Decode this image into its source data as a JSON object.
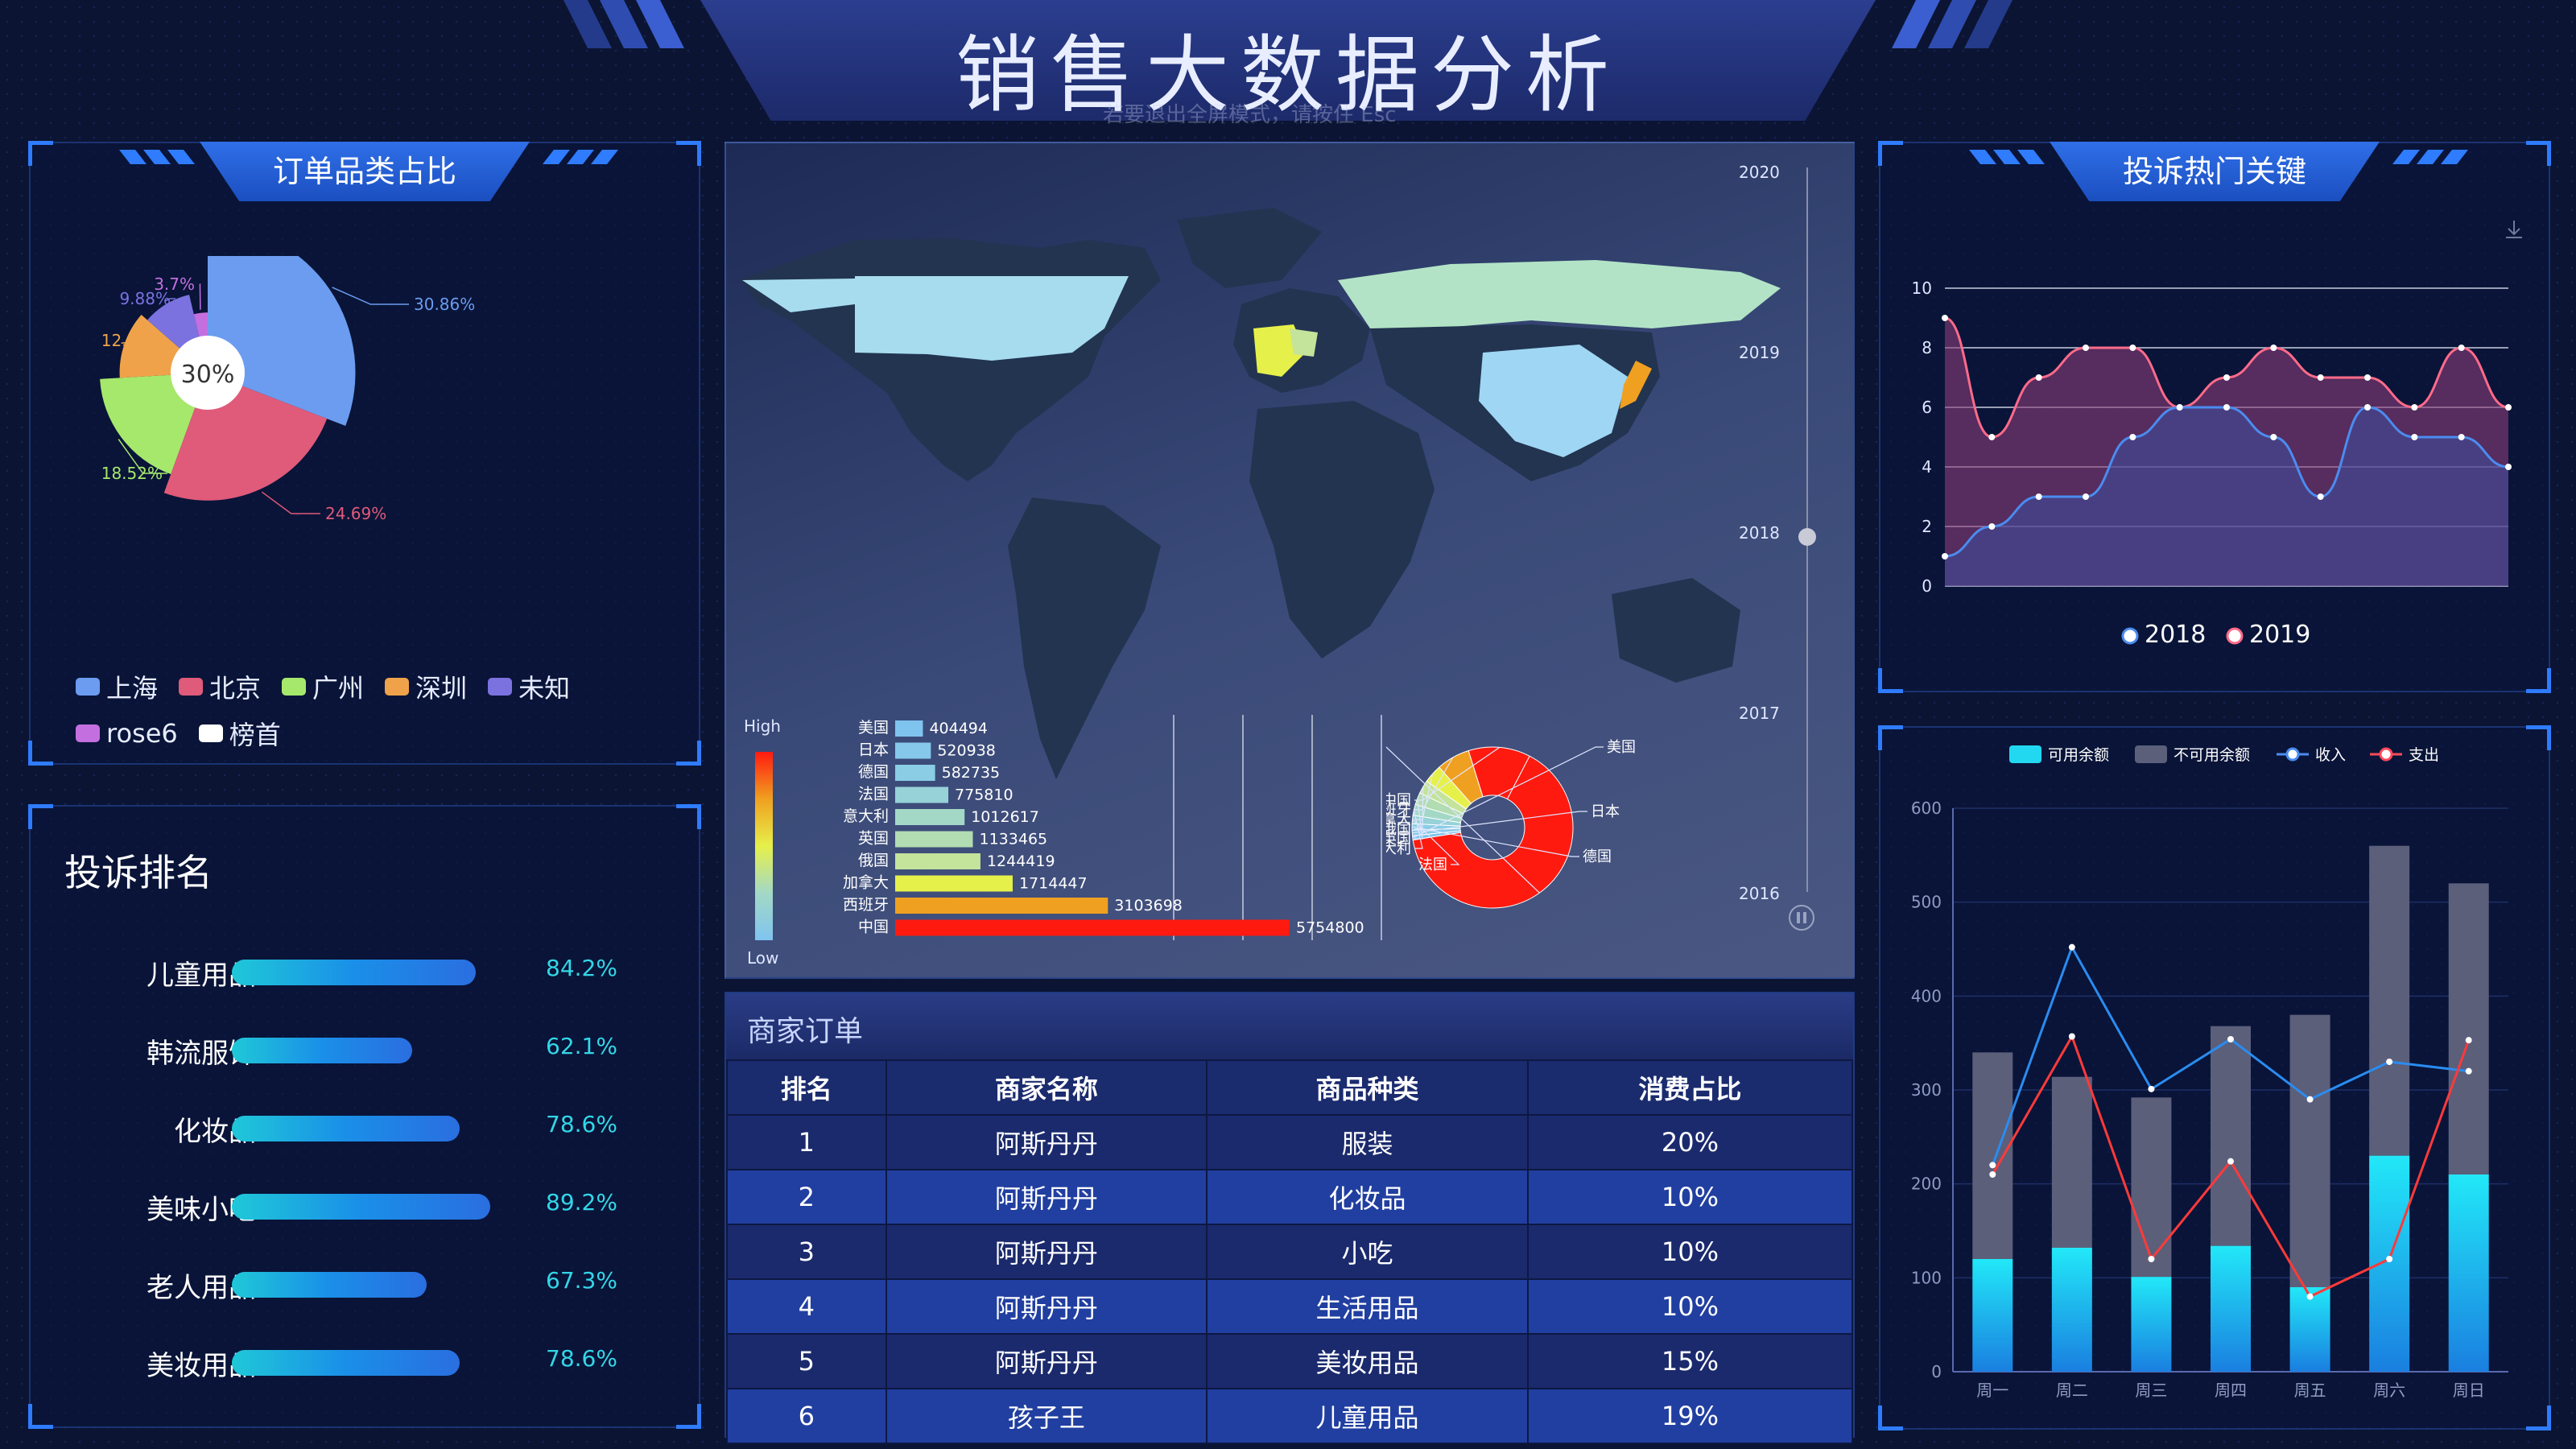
{
  "page": {
    "title": "销售大数据分析",
    "esc_tip": "若要退出全屏模式，请按住 Esc"
  },
  "colors": {
    "background": "#0b1433",
    "accent": "#2f7cff",
    "cyan": "#22d8f0"
  },
  "order_category_panel": {
    "title": "订单品类占比",
    "center_label": "30%",
    "legend": [
      {
        "name": "上海",
        "color": "#6b9cf0"
      },
      {
        "name": "北京",
        "color": "#e05a7a"
      },
      {
        "name": "广州",
        "color": "#a6e86b"
      },
      {
        "name": "深圳",
        "color": "#f0a24a"
      },
      {
        "name": "未知",
        "color": "#7b72e0"
      },
      {
        "name": "rose6",
        "color": "#c46fe0"
      },
      {
        "name": "榜首",
        "color": "#ffffff"
      }
    ]
  },
  "complaint_rank_panel": {
    "title": "投诉排名",
    "items": [
      {
        "name": "儿童用品",
        "value": 84.2,
        "label": "84.2%"
      },
      {
        "name": "韩流服饰",
        "value": 62.1,
        "label": "62.1%"
      },
      {
        "name": "化妆品",
        "value": 78.6,
        "label": "78.6%"
      },
      {
        "name": "美味小吃",
        "value": 89.2,
        "label": "89.2%"
      },
      {
        "name": "老人用品",
        "value": 67.3,
        "label": "67.3%"
      },
      {
        "name": "美妆用品",
        "value": 78.6,
        "label": "78.6%"
      }
    ]
  },
  "map_panel": {
    "timeline": [
      "2020",
      "2019",
      "2018",
      "2017",
      "2016"
    ],
    "timeline_current": "2018",
    "visual_map": {
      "high": "High",
      "low": "Low"
    },
    "countries_selected_regions": [
      "美国",
      "中国",
      "日本",
      "德国",
      "法国",
      "英国",
      "意大利",
      "西班牙",
      "加拿大",
      "俄国"
    ]
  },
  "complaint_keyword_panel": {
    "title": "投诉热门关键",
    "legend": [
      {
        "name": "2018",
        "color": "#4a8cf0"
      },
      {
        "name": "2019",
        "color": "#ff6b8a"
      }
    ]
  },
  "merchant_orders_panel": {
    "title": "商家订单",
    "headers": [
      "排名",
      "商家名称",
      "商品种类",
      "消费占比"
    ],
    "rows": [
      [
        "1",
        "阿斯丹丹",
        "服装",
        "20%"
      ],
      [
        "2",
        "阿斯丹丹",
        "化妆品",
        "10%"
      ],
      [
        "3",
        "阿斯丹丹",
        "小吃",
        "10%"
      ],
      [
        "4",
        "阿斯丹丹",
        "生活用品",
        "10%"
      ],
      [
        "5",
        "阿斯丹丹",
        "美妆用品",
        "15%"
      ],
      [
        "6",
        "孩子王",
        "儿童用品",
        "19%"
      ]
    ]
  },
  "balance_panel": {
    "legend": [
      {
        "name": "可用余额",
        "color": "#22d8f0"
      },
      {
        "name": "不可用余额",
        "color": "#5b5f7a"
      },
      {
        "name": "收入",
        "color": "#4a8cf0"
      },
      {
        "name": "支出",
        "color": "#ff4a5a"
      }
    ]
  },
  "chart_data": [
    {
      "type": "pie",
      "subtype": "rose",
      "title": "订单品类占比",
      "categories": [
        "上海",
        "北京",
        "广州",
        "深圳",
        "未知",
        "rose6"
      ],
      "values": [
        30.86,
        24.69,
        18.52,
        12.35,
        9.88,
        3.7
      ],
      "labels": [
        "30.86%",
        "24.69%",
        "18.52%",
        "12.35%",
        "9.88%",
        "3.7%"
      ],
      "colors": [
        "#6b9cf0",
        "#e05a7a",
        "#a6e86b",
        "#f0a24a",
        "#7b72e0",
        "#c46fe0"
      ]
    },
    {
      "type": "bar",
      "orientation": "horizontal",
      "title": "投诉排名",
      "categories": [
        "儿童用品",
        "韩流服饰",
        "化妆品",
        "美味小吃",
        "老人用品",
        "美妆用品"
      ],
      "values": [
        84.2,
        62.1,
        78.6,
        89.2,
        67.3,
        78.6
      ],
      "xlim": [
        0,
        100
      ]
    },
    {
      "type": "bar",
      "orientation": "horizontal",
      "title": "",
      "categories": [
        "美国",
        "日本",
        "德国",
        "法国",
        "意大利",
        "英国",
        "俄国",
        "加拿大",
        "西班牙",
        "中国"
      ],
      "values": [
        404494,
        520938,
        582735,
        775810,
        1012617,
        1133465,
        1244419,
        1714447,
        3103698,
        5754800
      ],
      "colors": [
        "#7fc4ef",
        "#86c8ea",
        "#8acde4",
        "#96d2d8",
        "#a3d8c6",
        "#b2dcb2",
        "#c4e39b",
        "#e6f04a",
        "#f0a020",
        "#ff1a10"
      ]
    },
    {
      "type": "pie",
      "subtype": "donut",
      "title": "",
      "categories": [
        "美国",
        "日本",
        "德国",
        "法国",
        "意大利",
        "英国",
        "俄国",
        "加拿大",
        "西班牙",
        "中国",
        "其他国家"
      ],
      "values": [
        404494,
        520938,
        582735,
        775810,
        1012617,
        1133465,
        1244419,
        1714447,
        3103698,
        5754800,
        30000000
      ],
      "colors": [
        "#7fc4ef",
        "#86c8ea",
        "#8acde4",
        "#96d2d8",
        "#a3d8c6",
        "#b2dcb2",
        "#c4e39b",
        "#e6f04a",
        "#f0a020",
        "#ff1a10",
        "#ff1a10"
      ]
    },
    {
      "type": "area",
      "title": "投诉热门关键",
      "x": [
        1,
        2,
        3,
        4,
        5,
        6,
        7,
        8,
        9,
        10,
        11,
        12
      ],
      "series": [
        {
          "name": "2018",
          "values": [
            1,
            2,
            3,
            3,
            5,
            6,
            6,
            5,
            3,
            6,
            5,
            5,
            4
          ]
        },
        {
          "name": "2019",
          "values": [
            9,
            5,
            7,
            8,
            8,
            6,
            7,
            8,
            7,
            7,
            6,
            8,
            6
          ]
        }
      ],
      "ylim": [
        0,
        10
      ],
      "yticks": [
        0,
        2,
        4,
        6,
        8,
        10
      ]
    },
    {
      "type": "bar",
      "stacked": true,
      "title": "",
      "categories": [
        "周一",
        "周二",
        "周三",
        "周四",
        "周五",
        "周六",
        "周日"
      ],
      "series": [
        {
          "name": "可用余额",
          "kind": "bar",
          "values": [
            120,
            132,
            101,
            134,
            90,
            230,
            210
          ]
        },
        {
          "name": "不可用余额",
          "kind": "bar",
          "values": [
            220,
            182,
            191,
            234,
            290,
            330,
            310
          ]
        },
        {
          "name": "收入",
          "kind": "line",
          "values": [
            220,
            452,
            301,
            354,
            290,
            330,
            320
          ]
        },
        {
          "name": "支出",
          "kind": "line",
          "values": [
            210,
            357,
            120,
            224,
            80,
            120,
            353
          ]
        }
      ],
      "ylim": [
        0,
        600
      ],
      "yticks": [
        0,
        100,
        200,
        300,
        400,
        500,
        600
      ]
    }
  ]
}
